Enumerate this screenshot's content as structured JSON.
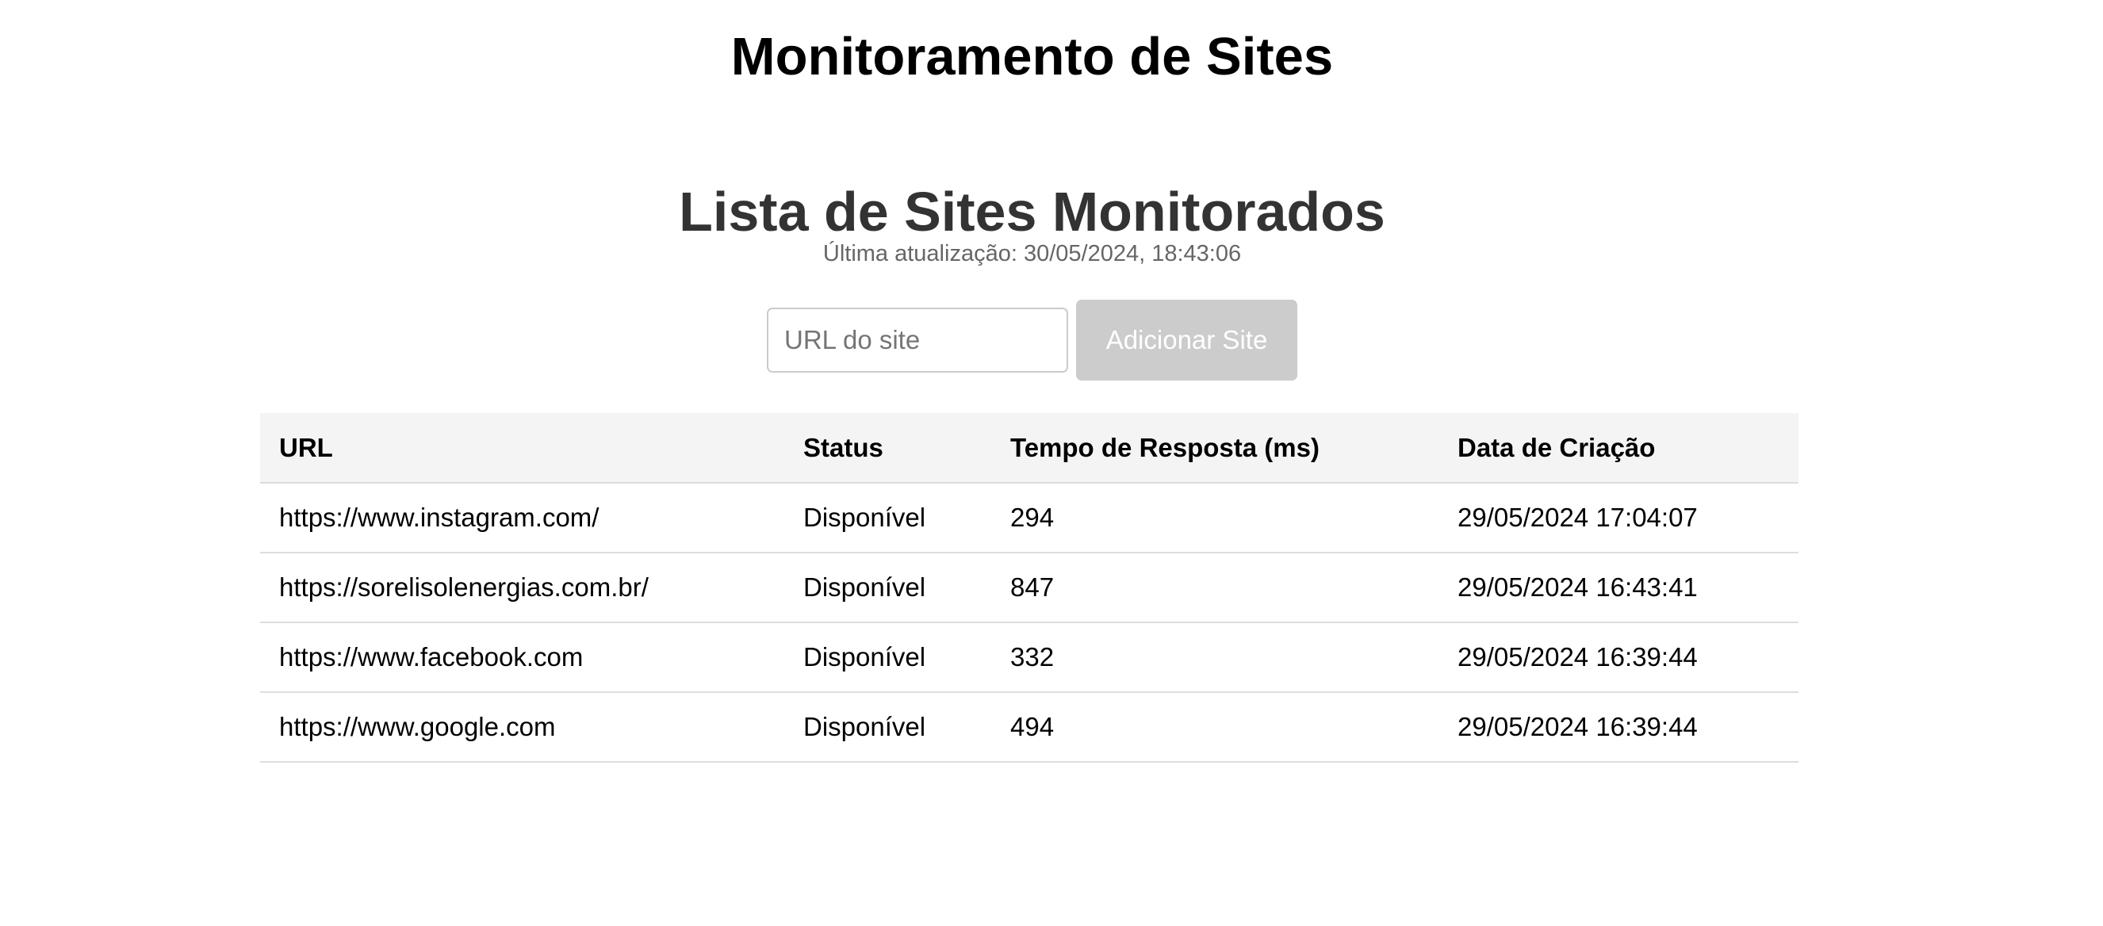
{
  "header": {
    "title": "Monitoramento de Sites"
  },
  "section": {
    "title": "Lista de Sites Monitorados",
    "last_update_label": "Última atualização:",
    "last_update_value": "30/05/2024, 18:43:06"
  },
  "form": {
    "url_placeholder": "URL do site",
    "url_value": "",
    "add_button_label": "Adicionar Site"
  },
  "table": {
    "columns": [
      "URL",
      "Status",
      "Tempo de Resposta (ms)",
      "Data de Criação"
    ],
    "rows": [
      {
        "url": "https://www.instagram.com/",
        "status": "Disponível",
        "response_time": "294",
        "created": "29/05/2024 17:04:07"
      },
      {
        "url": "https://sorelisolenergias.com.br/",
        "status": "Disponível",
        "response_time": "847",
        "created": "29/05/2024 16:43:41"
      },
      {
        "url": "https://www.facebook.com",
        "status": "Disponível",
        "response_time": "332",
        "created": "29/05/2024 16:39:44"
      },
      {
        "url": "https://www.google.com",
        "status": "Disponível",
        "response_time": "494",
        "created": "29/05/2024 16:39:44"
      }
    ]
  },
  "colors": {
    "status_available": "#2a7a1b",
    "button_disabled": "#cccccc",
    "header_bg": "#f4f4f4"
  }
}
